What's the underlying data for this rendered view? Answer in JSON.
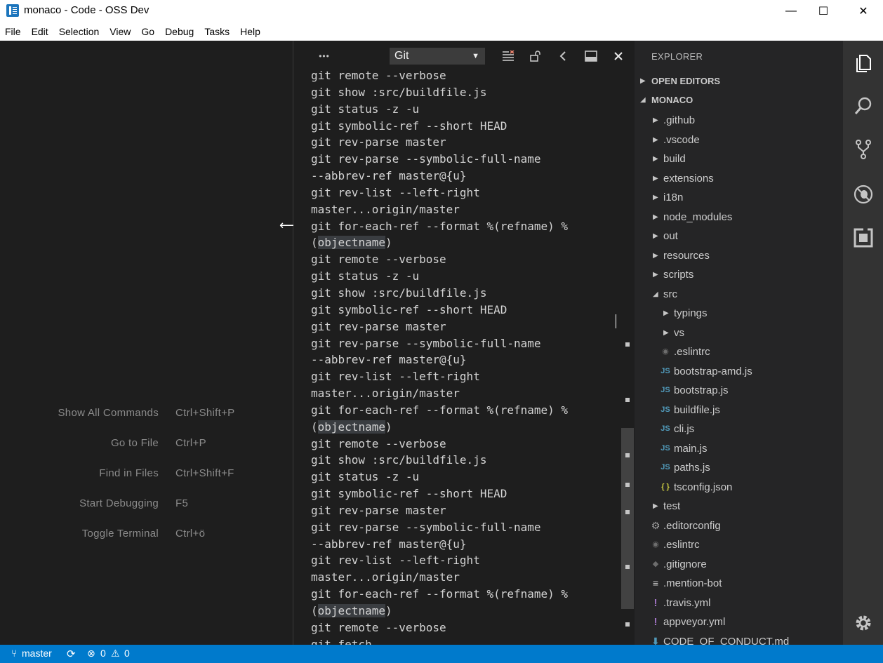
{
  "window": {
    "title": "monaco - Code - OSS Dev",
    "minimize": "—",
    "maximize": "☐",
    "close": "✕"
  },
  "menu": [
    "File",
    "Edit",
    "Selection",
    "View",
    "Go",
    "Debug",
    "Tasks",
    "Help"
  ],
  "welcome_shortcuts": [
    {
      "label": "Show All Commands",
      "keys": "Ctrl+Shift+P"
    },
    {
      "label": "Go to File",
      "keys": "Ctrl+P"
    },
    {
      "label": "Find in Files",
      "keys": "Ctrl+Shift+F"
    },
    {
      "label": "Start Debugging",
      "keys": "F5"
    },
    {
      "label": "Toggle Terminal",
      "keys": "Ctrl+ö"
    }
  ],
  "output_panel": {
    "more_actions": "•••",
    "channel": "Git",
    "lines": [
      "git remote --verbose",
      "git show :src/buildfile.js",
      "git status -z -u",
      "git symbolic-ref --short HEAD",
      "git rev-parse master",
      "git rev-parse --symbolic-full-name",
      "--abbrev-ref master@{u}",
      "git rev-list --left-right",
      "master...origin/master",
      "git for-each-ref --format %(refname) %",
      "(objectname)",
      "git remote --verbose",
      "git status -z -u",
      "git show :src/buildfile.js",
      "git symbolic-ref --short HEAD",
      "git rev-parse master",
      "git rev-parse --symbolic-full-name",
      "--abbrev-ref master@{u}",
      "git rev-list --left-right",
      "master...origin/master",
      "git for-each-ref --format %(refname) %",
      "(objectname)",
      "git remote --verbose",
      "git show :src/buildfile.js",
      "git status -z -u",
      "git symbolic-ref --short HEAD",
      "git rev-parse master",
      "git rev-parse --symbolic-full-name",
      "--abbrev-ref master@{u}",
      "git rev-list --left-right",
      "master...origin/master",
      "git for-each-ref --format %(refname) %",
      "(objectname)",
      "git remote --verbose",
      "git fetch"
    ]
  },
  "explorer": {
    "title": "EXPLORER",
    "open_editors": "OPEN EDITORS",
    "workspace": "MONACO",
    "items": [
      {
        "label": ".github",
        "kind": "folder",
        "depth": 1,
        "expanded": false
      },
      {
        "label": ".vscode",
        "kind": "folder",
        "depth": 1,
        "expanded": false
      },
      {
        "label": "build",
        "kind": "folder",
        "depth": 1,
        "expanded": false
      },
      {
        "label": "extensions",
        "kind": "folder",
        "depth": 1,
        "expanded": false
      },
      {
        "label": "i18n",
        "kind": "folder",
        "depth": 1,
        "expanded": false
      },
      {
        "label": "node_modules",
        "kind": "folder",
        "depth": 1,
        "expanded": false
      },
      {
        "label": "out",
        "kind": "folder",
        "depth": 1,
        "expanded": false
      },
      {
        "label": "resources",
        "kind": "folder",
        "depth": 1,
        "expanded": false
      },
      {
        "label": "scripts",
        "kind": "folder",
        "depth": 1,
        "expanded": false
      },
      {
        "label": "src",
        "kind": "folder",
        "depth": 1,
        "expanded": true
      },
      {
        "label": "typings",
        "kind": "folder",
        "depth": 2,
        "expanded": false
      },
      {
        "label": "vs",
        "kind": "folder",
        "depth": 2,
        "expanded": false
      },
      {
        "label": ".eslintrc",
        "kind": "eslint",
        "depth": 2
      },
      {
        "label": "bootstrap-amd.js",
        "kind": "js",
        "depth": 2
      },
      {
        "label": "bootstrap.js",
        "kind": "js",
        "depth": 2
      },
      {
        "label": "buildfile.js",
        "kind": "js",
        "depth": 2
      },
      {
        "label": "cli.js",
        "kind": "js",
        "depth": 2
      },
      {
        "label": "main.js",
        "kind": "js",
        "depth": 2
      },
      {
        "label": "paths.js",
        "kind": "js",
        "depth": 2
      },
      {
        "label": "tsconfig.json",
        "kind": "json",
        "depth": 2
      },
      {
        "label": "test",
        "kind": "folder",
        "depth": 1,
        "expanded": false
      },
      {
        "label": ".editorconfig",
        "kind": "gear",
        "depth": 1
      },
      {
        "label": ".eslintrc",
        "kind": "eslint",
        "depth": 1
      },
      {
        "label": ".gitignore",
        "kind": "git",
        "depth": 1
      },
      {
        "label": ".mention-bot",
        "kind": "lines",
        "depth": 1
      },
      {
        "label": ".travis.yml",
        "kind": "yml",
        "depth": 1
      },
      {
        "label": "appveyor.yml",
        "kind": "yml",
        "depth": 1
      },
      {
        "label": "CODE_OF_CONDUCT.md",
        "kind": "md",
        "depth": 1
      }
    ]
  },
  "icon_glyphs": {
    "js": "JS",
    "json": "{ }",
    "eslint": "◉",
    "gear": "⚙",
    "git": "◆",
    "lines": "≡",
    "yml": "!",
    "md": "⬇"
  },
  "status": {
    "branch": "master",
    "errors": "0",
    "warnings": "0"
  },
  "colors": {
    "accent": "#007acc",
    "js_icon": "#519aba",
    "json_icon": "#cbcb41",
    "yml_icon": "#a074c4",
    "eslint_icon": "#6d6d6d",
    "md_icon": "#519aba"
  }
}
